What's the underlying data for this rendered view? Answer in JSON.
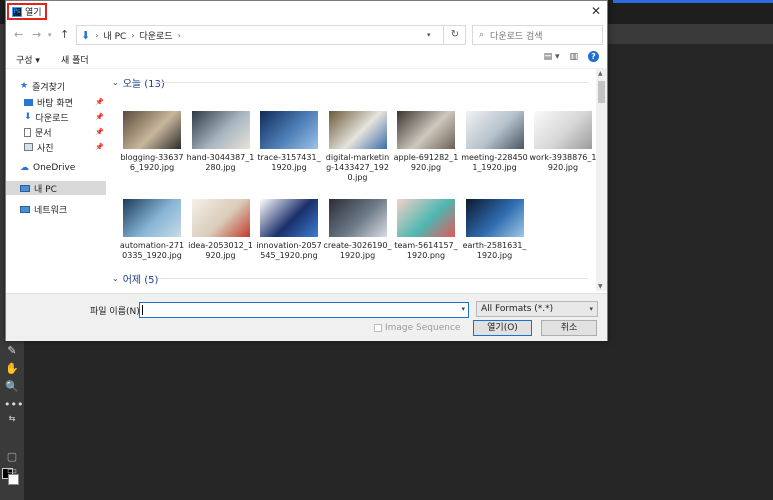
{
  "dialog": {
    "title": "열기",
    "address": {
      "items": [
        "내 PC",
        "다운로드"
      ]
    },
    "search_placeholder": "다운로드 검색",
    "toolbar": {
      "organize": "구성",
      "new_folder": "새 폴더"
    },
    "sidebar": {
      "items": [
        {
          "label": "즐겨찾기",
          "icon": "star-icon"
        },
        {
          "label": "바탕 화면",
          "icon": "desktop-icon",
          "pinned": true
        },
        {
          "label": "다운로드",
          "icon": "download-icon",
          "pinned": true
        },
        {
          "label": "문서",
          "icon": "document-icon",
          "pinned": true
        },
        {
          "label": "사진",
          "icon": "picture-icon",
          "pinned": true
        },
        {
          "label": "OneDrive",
          "icon": "cloud-icon"
        },
        {
          "label": "내 PC",
          "icon": "pc-icon",
          "selected": true
        },
        {
          "label": "네트워크",
          "icon": "network-icon"
        }
      ]
    },
    "groups": [
      {
        "label": "오늘 (13)",
        "files": [
          {
            "name": "blogging-336376_1920.jpg",
            "colors": [
              "#5a4a3a",
              "#c9b79c",
              "#2c2c2c"
            ]
          },
          {
            "name": "hand-3044387_1280.jpg",
            "colors": [
              "#2f3a44",
              "#a8b6c1",
              "#e8e2d8"
            ]
          },
          {
            "name": "trace-3157431_1920.jpg",
            "colors": [
              "#0f2c5a",
              "#4f7fb8",
              "#9cc2e8"
            ]
          },
          {
            "name": "digital-marketing-1433427_1920.jpg",
            "colors": [
              "#6a5a3a",
              "#e6e3dc",
              "#3a6ea8"
            ]
          },
          {
            "name": "apple-691282_1920.jpg",
            "colors": [
              "#3a3530",
              "#cfc8bd",
              "#6b6057"
            ]
          },
          {
            "name": "meeting-2284501_1920.jpg",
            "colors": [
              "#f2f2f2",
              "#b3c1cc",
              "#4a5560"
            ]
          },
          {
            "name": "work-3938876_1920.jpg",
            "colors": [
              "#fafafa",
              "#d6d6d6",
              "#9c9c9c"
            ]
          },
          {
            "name": "automation-2710335_1920.jpg",
            "colors": [
              "#1d3b5c",
              "#87b4d4",
              "#c8dbe8"
            ]
          },
          {
            "name": "idea-2053012_1920.jpg",
            "colors": [
              "#f4f0ea",
              "#d9cbb8",
              "#c23a2a"
            ]
          },
          {
            "name": "innovation-2057545_1920.png",
            "colors": [
              "#ffffff",
              "#1b2f6b",
              "#3a7fd1"
            ]
          },
          {
            "name": "create-3026190_1920.jpg",
            "colors": [
              "#2a2e36",
              "#6d7a88",
              "#d9dde2"
            ]
          },
          {
            "name": "team-5614157_1920.png",
            "colors": [
              "#f3d1c8",
              "#4fb7b2",
              "#e05a5a"
            ]
          },
          {
            "name": "earth-2581631_1920.jpg",
            "colors": [
              "#0a1a30",
              "#2f6cb0",
              "#9fc8e6"
            ]
          }
        ]
      },
      {
        "label": "어제 (5)",
        "files": []
      }
    ],
    "filename_label": "파일 이름(N):",
    "filename_value": "",
    "format": "All Formats (*.*)",
    "image_sequence": "Image Sequence",
    "open_button": "열기(O)",
    "cancel_button": "취소"
  }
}
